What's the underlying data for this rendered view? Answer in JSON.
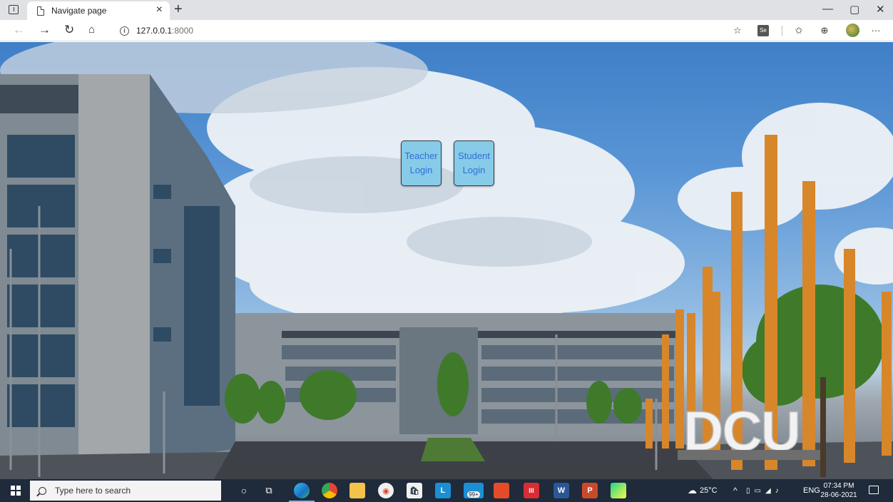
{
  "browser": {
    "tab_title": "Navigate page",
    "tab_close": "×",
    "new_tab": "+",
    "url_host": "127.0.0.1",
    "url_port": ":8000",
    "window_controls": {
      "minimize": "—",
      "maximize": "▢",
      "close": "✕"
    },
    "nav_icons": [
      "back-icon",
      "forward-icon",
      "refresh-icon",
      "home-icon"
    ],
    "toolbar_icons": [
      "favorite-icon",
      "extension-icon",
      "favorites-icon",
      "collections-icon",
      "profile-icon",
      "more-icon"
    ],
    "more_label": "···"
  },
  "page": {
    "teacher_login": {
      "line1": "Teacher",
      "line2": "Login"
    },
    "student_login": {
      "line1": "Student",
      "line2": "Login"
    },
    "background_sign": "DCU"
  },
  "taskbar": {
    "search_placeholder": "Type here to search",
    "apps": [
      "cortana-icon",
      "task-view-icon",
      "edge-icon",
      "chrome-icon",
      "file-explorer-icon",
      "media-player-icon",
      "store-icon",
      "l-app-icon",
      "mail-icon",
      "office-icon",
      "app-red-icon",
      "word-icon",
      "powerpoint-icon",
      "pycharm-icon"
    ],
    "l_app_letter": "L",
    "mail_badge": "99+",
    "word_letter": "W",
    "powerpoint_letter": "P",
    "weather": "25°C",
    "language": "ENG",
    "time": "07:34 PM",
    "date": "28-06-2021"
  },
  "colors": {
    "button_bg": "#87cbe8",
    "button_text": "#2f6fd6",
    "taskbar_bg": "#1f2a3a"
  }
}
